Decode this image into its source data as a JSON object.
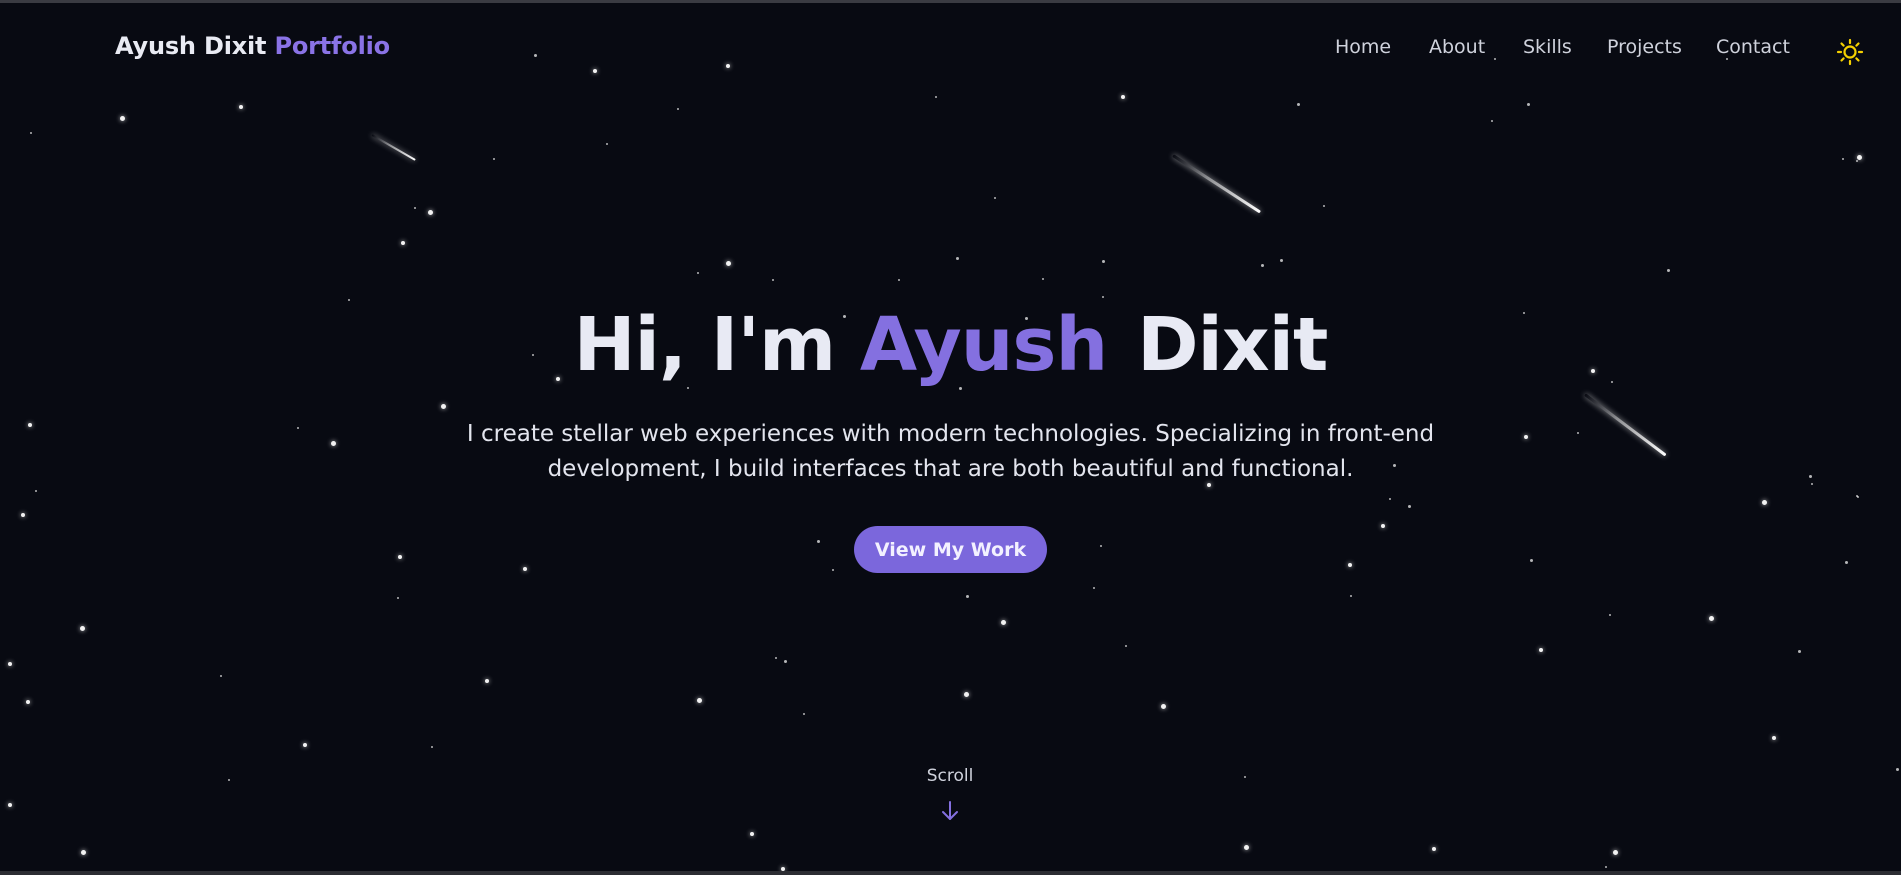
{
  "header": {
    "brand_name": "Ayush Dixit",
    "brand_accent": "Portfolio",
    "nav": [
      {
        "label": "Home"
      },
      {
        "label": "About"
      },
      {
        "label": "Skills"
      },
      {
        "label": "Projects"
      },
      {
        "label": "Contact"
      }
    ],
    "theme_toggle_icon": "sun-icon"
  },
  "hero": {
    "title_prefix": "Hi, I'm",
    "title_accent": "Ayush",
    "title_suffix": "Dixit",
    "subtitle_line1": "I create stellar web experiences with modern technologies. Specializing in front-end",
    "subtitle_line2": "development, I build interfaces that are both beautiful and functional.",
    "cta_label": "View My Work"
  },
  "scroll": {
    "label": "Scroll",
    "icon": "arrow-down-icon"
  },
  "colors": {
    "background": "#080a12",
    "accent": "#8470e0",
    "button": "#7b67dc",
    "sun": "#f5d000",
    "text": "#e8eaf4"
  }
}
